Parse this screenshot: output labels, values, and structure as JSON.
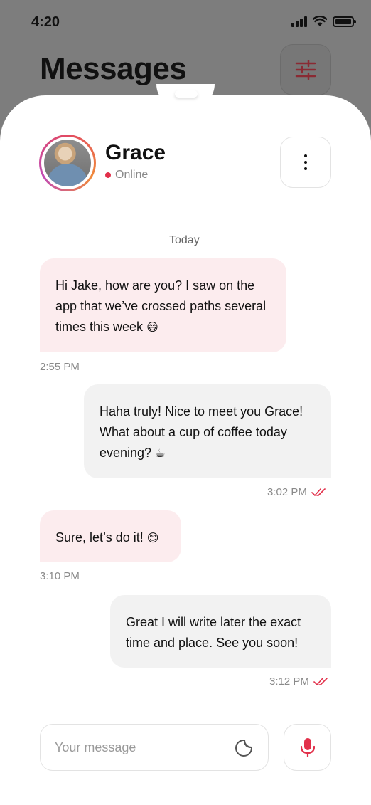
{
  "status_bar": {
    "time": "4:20"
  },
  "header": {
    "title": "Messages"
  },
  "contact": {
    "name": "Grace",
    "status": "Online"
  },
  "chat": {
    "date_divider": "Today",
    "messages": [
      {
        "direction": "incoming",
        "text": "Hi Jake, how are you? I saw on the app that we’ve crossed paths several times this week",
        "emoji": "😄",
        "time": "2:55 PM"
      },
      {
        "direction": "outgoing",
        "text": "Haha truly! Nice to meet you Grace! What about a cup of coffee today evening?",
        "emoji": "☕",
        "time": "3:02 PM",
        "read": true
      },
      {
        "direction": "incoming",
        "text": "Sure, let’s do it!",
        "emoji": "😊",
        "time": "3:10 PM"
      },
      {
        "direction": "outgoing",
        "text": "Great I will write later the exact time and place. See you soon!",
        "emoji": "",
        "time": "3:12 PM",
        "read": true
      }
    ]
  },
  "composer": {
    "placeholder": "Your message",
    "value": ""
  },
  "colors": {
    "accent": "#e2304a",
    "incoming_bubble": "#fcecee",
    "outgoing_bubble": "#f2f2f2"
  }
}
